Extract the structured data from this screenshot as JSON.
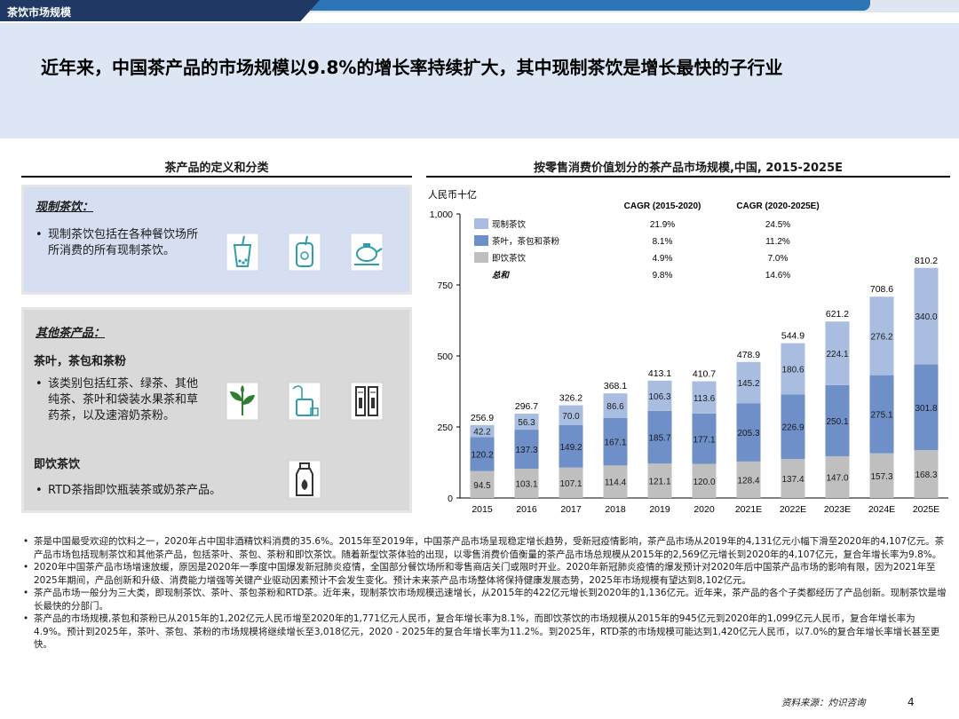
{
  "header": {
    "section": "茶饮市场规模"
  },
  "headline": "近年来，中国茶产品的市场规模以9.8%的增长率持续扩大，其中现制茶饮是增长最快的子行业",
  "left_panel": {
    "title": "茶产品的定义和分类",
    "box1": {
      "heading": "现制茶饮：",
      "bullet": "现制茶饮包括在各种餐饮场所所消费的所有现制茶饮。"
    },
    "box2": {
      "heading": "其他茶产品：",
      "sub1": "茶叶，茶包和茶粉",
      "bullet1": "该类别包括红茶、绿茶、其他纯茶、茶叶和袋装水果茶和草药茶，以及速溶奶茶粉。",
      "sub2": "即饮茶饮",
      "bullet2": "RTD茶指即饮瓶装茶或奶茶产品。"
    },
    "icons": [
      "bubble-tea-cup-icon",
      "fruit-tea-jar-icon",
      "teapot-icon",
      "tea-leaf-icon",
      "tea-bag-icon",
      "tea-powder-sachet-icon",
      "bottled-tea-icon"
    ]
  },
  "right_panel": {
    "title": "按零售消费价值划分的茶产品市场规模,中国, 2015-2025E"
  },
  "chart_data": {
    "type": "bar",
    "stacked": true,
    "ylabel": "人民币十亿",
    "ylim": [
      0,
      1000
    ],
    "yticks": [
      "0",
      "250",
      "500",
      "750",
      "1,000"
    ],
    "categories": [
      "2015",
      "2016",
      "2017",
      "2018",
      "2019",
      "2020",
      "2021E",
      "2022E",
      "2023E",
      "2024E",
      "2025E"
    ],
    "series": [
      {
        "name": "即饮茶饮",
        "color": "#bfbfbf",
        "values": [
          94.5,
          103.1,
          107.1,
          114.4,
          121.1,
          120.0,
          128.4,
          137.4,
          147.0,
          157.3,
          168.3
        ]
      },
      {
        "name": "茶叶，茶包和茶粉",
        "color": "#6f8fc9",
        "values": [
          120.2,
          137.3,
          149.2,
          167.1,
          185.7,
          177.1,
          205.3,
          226.9,
          250.1,
          275.1,
          301.8
        ]
      },
      {
        "name": "现制茶饮",
        "color": "#a9bde0",
        "values": [
          42.2,
          56.3,
          70.0,
          86.6,
          106.3,
          113.6,
          145.2,
          180.6,
          224.1,
          276.2,
          340.0
        ]
      }
    ],
    "totals": [
      "256.9",
      "296.7",
      "326.2",
      "368.1",
      "413.1",
      "410.7",
      "478.9",
      "544.9",
      "621.2",
      "708.6",
      "810.2"
    ],
    "legend": {
      "cagr_headers": [
        "CAGR (2015-2020)",
        "CAGR (2020-2025E)"
      ],
      "rows": [
        {
          "name": "现制茶饮",
          "color": "#a9bde0",
          "c1": "21.9%",
          "c2": "24.5%"
        },
        {
          "name": "茶叶，茶包和茶粉",
          "color": "#6f8fc9",
          "c1": "8.1%",
          "c2": "11.2%"
        },
        {
          "name": "即饮茶饮",
          "color": "#bfbfbf",
          "c1": "4.9%",
          "c2": "7.0%"
        },
        {
          "name": "总和",
          "color": "",
          "c1": "9.8%",
          "c2": "14.6%"
        }
      ]
    }
  },
  "notes": [
    "茶是中国最受欢迎的饮料之一，2020年占中国非酒精饮料消费的35.6%。2015年至2019年，中国茶产品市场呈现稳定增长趋势，受新冠疫情影响，茶产品市场从2019年的4,131亿元小幅下滑至2020年的4,107亿元。茶产品市场包括现制茶饮和其他茶产品，包括茶叶、茶包、茶粉和即饮茶饮。随着新型饮茶体验的出现，以零售消费价值衡量的茶产品市场总规模从2015年的2,569亿元增长到2020年的4,107亿元，复合年增长率为9.8%。",
    "2020年中国茶产品市场增速放缓，原因是2020年一季度中国爆发新冠肺炎疫情，全国部分餐饮场所和零售商店关门或限时开业。2020年新冠肺炎疫情的爆发预计对2020年后中国茶产品市场的影响有限，因为2021年至2025年期间，产品创新和升级、消费能力增强等关键产业驱动因素预计不会发生变化。预计未来茶产品市场整体将保持健康发展态势，2025年市场规模有望达到8,102亿元。",
    "茶产品市场一般分为三大类，即现制茶饮、茶叶、茶包茶粉和RTD茶。近年来，现制茶饮市场规模迅速增长，从2015年的422亿元增长到2020年的1,136亿元。近年来，茶产品的各个子类都经历了产品创新。现制茶饮是增长最快的分部门。",
    "茶产品的市场规模,茶包和茶粉已从2015年的1,202亿元人民币增至2020年的1,771亿元人民币，复合年增长率为8.1%，而即饮茶饮的市场规模从2015年的945亿元到2020年的1,099亿元人民币，复合年增长率为4.9%。预计到2025年，茶叶、茶包、茶粉的市场规模将继续增长至3,018亿元，2020 - 2025年的复合年增长率为11.2%。到2025年，RTD茶的市场规模可能达到1,420亿元人民币，以7.0%的复合年增长率增长甚至更快。"
  ],
  "footer": {
    "source": "资料来源：灼识咨询",
    "page": "4"
  }
}
